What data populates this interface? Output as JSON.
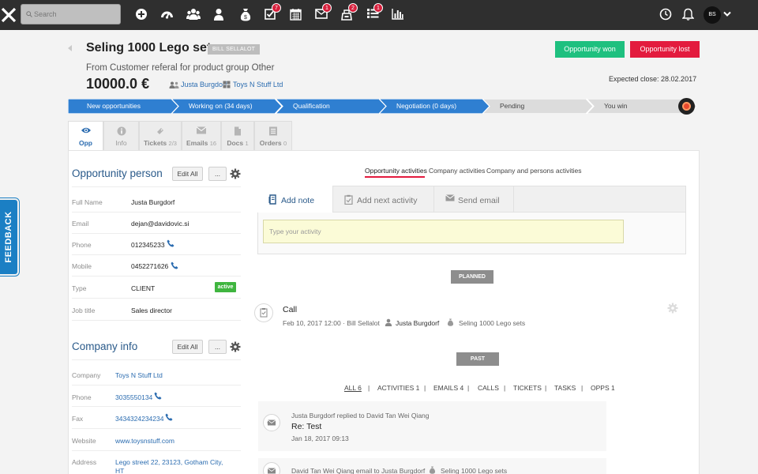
{
  "topbar": {
    "logo_icon": "x-logo-icon",
    "search_placeholder": "Search",
    "nav": [
      {
        "icon": "plus-circle-icon",
        "badge": ""
      },
      {
        "icon": "dashboard-icon",
        "badge": ""
      },
      {
        "icon": "users-icon",
        "badge": ""
      },
      {
        "icon": "user-icon",
        "badge": ""
      },
      {
        "icon": "money-bag-icon",
        "badge": ""
      },
      {
        "icon": "tasks-check-icon",
        "badge": "7"
      },
      {
        "icon": "calendar-icon",
        "badge": ""
      },
      {
        "icon": "mail-icon",
        "badge": "1"
      },
      {
        "icon": "inbox-icon",
        "badge": "2"
      },
      {
        "icon": "list-icon",
        "badge": "1"
      },
      {
        "icon": "bar-chart-icon",
        "badge": ""
      }
    ],
    "right_icons": [
      "clock-icon",
      "bell-icon"
    ],
    "avatar_initials": "BS",
    "accent_badge_color": "#d71f3c"
  },
  "header": {
    "title": "Seling 1000 Lego sets",
    "owner_tag": "BILL SELLALOT",
    "subtitle": "From Customer referal for product group Other",
    "amount": "10000.0 €",
    "contact": "Justa Burgdorf",
    "company": "Toys N Stuff Ltd",
    "won_label": "Opportunity won",
    "lost_label": "Opportunity lost",
    "expected_close": "Expected close: 28.02.2017",
    "won_color": "#1ec07f",
    "lost_color": "#e31b3e"
  },
  "pipeline": {
    "stages": [
      {
        "label": "New opportunities",
        "state": "done"
      },
      {
        "label": "Working on (34 days)",
        "state": "done"
      },
      {
        "label": "Qualification",
        "state": "done"
      },
      {
        "label": "Negotiation (0 days)",
        "state": "current"
      },
      {
        "label": "Pending",
        "state": "todo"
      },
      {
        "label": "You win",
        "state": "todo"
      }
    ],
    "done_color": "#2f7fd1",
    "todo_color": "#dcdcdc"
  },
  "tabs": [
    {
      "label": "Opp",
      "count": "",
      "icon": "eye-icon",
      "active": true
    },
    {
      "label": "Info",
      "count": "",
      "icon": "info-icon",
      "active": false
    },
    {
      "label": "Tickets",
      "count": "2/3",
      "icon": "ticket-icon",
      "active": false
    },
    {
      "label": "Emails",
      "count": "16",
      "icon": "envelope-icon",
      "active": false
    },
    {
      "label": "Docs",
      "count": "1",
      "icon": "document-icon",
      "active": false
    },
    {
      "label": "Orders",
      "count": "0",
      "icon": "orders-icon",
      "active": false
    }
  ],
  "person": {
    "title": "Opportunity person",
    "edit_label": "Edit All",
    "more_label": "...",
    "fields": [
      {
        "label": "Full Name",
        "value": "Justa Burgdorf"
      },
      {
        "label": "Email",
        "value": "dejan@davidovic.si"
      },
      {
        "label": "Phone",
        "value": "012345233"
      },
      {
        "label": "Mobile",
        "value": "0452271626"
      },
      {
        "label": "Type",
        "value": "CLIENT"
      },
      {
        "label": "Job title",
        "value": "Sales director"
      }
    ],
    "type_badge": "active"
  },
  "company": {
    "title": "Company info",
    "edit_label": "Edit All",
    "more_label": "...",
    "fields": [
      {
        "label": "Company",
        "value": "Toys N Stuff Ltd"
      },
      {
        "label": "Phone",
        "value": "3035550134"
      },
      {
        "label": "Fax",
        "value": "3434324234234"
      },
      {
        "label": "Website",
        "value": "www.toysnstuff.com"
      },
      {
        "label": "Address",
        "value": "Lego street 22, 23123, Gotham City,"
      },
      {
        "label": "",
        "value": "HT"
      }
    ]
  },
  "activities": {
    "view_tabs": [
      "Opportunity activities",
      "Company activities",
      "Company and persons activities"
    ],
    "buttons": [
      {
        "label": "Add note",
        "icon": "note-icon"
      },
      {
        "label": "Add next activity",
        "icon": "clipboard-icon"
      },
      {
        "label": "Send email",
        "icon": "envelope-icon"
      }
    ],
    "input_placeholder": "Type your activity",
    "planned_label": "PLANNED",
    "planned_item": {
      "title": "Call",
      "datetime": "Feb 10, 2017 12:00 · Bill Sellalot",
      "person": "Justa Burgdorf",
      "opportunity": "Seling 1000 Lego sets"
    },
    "past_label": "PAST",
    "filters": [
      "ALL 6",
      "ACTIVITIES 1",
      "EMAILS 4",
      "CALLS",
      "TICKETS",
      "TASKS",
      "OPPS 1"
    ],
    "past_items": [
      {
        "line": "Justa Burgdorf replied to David Tan Wei Qiang",
        "subject": "Re: Test",
        "date": "Jan 18, 2017 09:13"
      },
      {
        "line": "David Tan Wei Qiang email to Justa Burgdorf",
        "opportunity": "Seling 1000 Lego sets"
      }
    ]
  },
  "feedback_label": "FEEDBACK"
}
